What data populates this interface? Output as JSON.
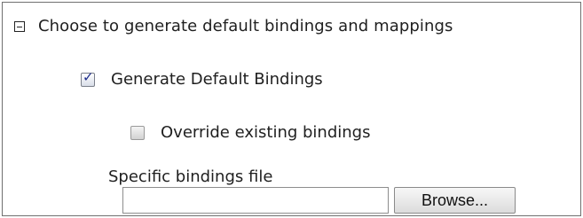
{
  "section": {
    "icon": "collapse-icon",
    "title": "Choose to generate default bindings and mappings"
  },
  "options": {
    "generate_default": {
      "label": "Generate Default Bindings",
      "checked": true
    },
    "override_existing": {
      "label": "Override existing bindings",
      "checked": false
    }
  },
  "bindings_file": {
    "label": "Specific bindings file",
    "value": "",
    "browse_label": "Browse..."
  }
}
